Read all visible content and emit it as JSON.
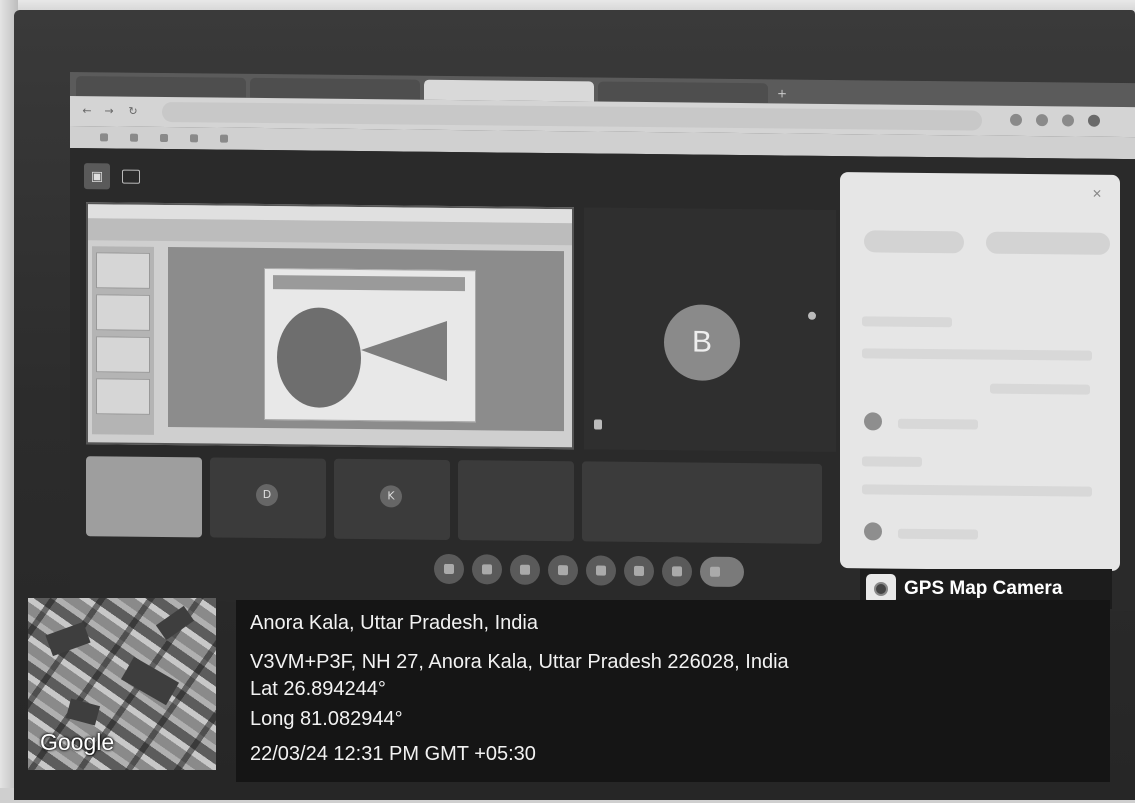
{
  "browser": {
    "tabs": [
      "",
      "",
      "",
      ""
    ],
    "active_tab": 2,
    "url": "",
    "bookmarks": [
      "",
      "",
      "",
      "",
      ""
    ]
  },
  "meet": {
    "presenter_label": "",
    "participant_initial": "B",
    "participant_name": "",
    "strip_initials": [
      "",
      "D",
      "K",
      "",
      "",
      ""
    ],
    "strip_names": [
      "",
      "",
      "",
      "",
      "",
      ""
    ],
    "time_label": "",
    "people_panel": {
      "title": "",
      "buttons": [
        "",
        ""
      ],
      "search_placeholder": ""
    }
  },
  "gps": {
    "app_name": "GPS Map Camera",
    "place": "Anora Kala, Uttar Pradesh, India",
    "address": "V3VM+P3F, NH 27, Anora Kala, Uttar Pradesh 226028, India",
    "lat": "Lat 26.894244°",
    "long": "Long 81.082944°",
    "datetime": "22/03/24 12:31 PM GMT +05:30",
    "map_provider": "Google"
  }
}
